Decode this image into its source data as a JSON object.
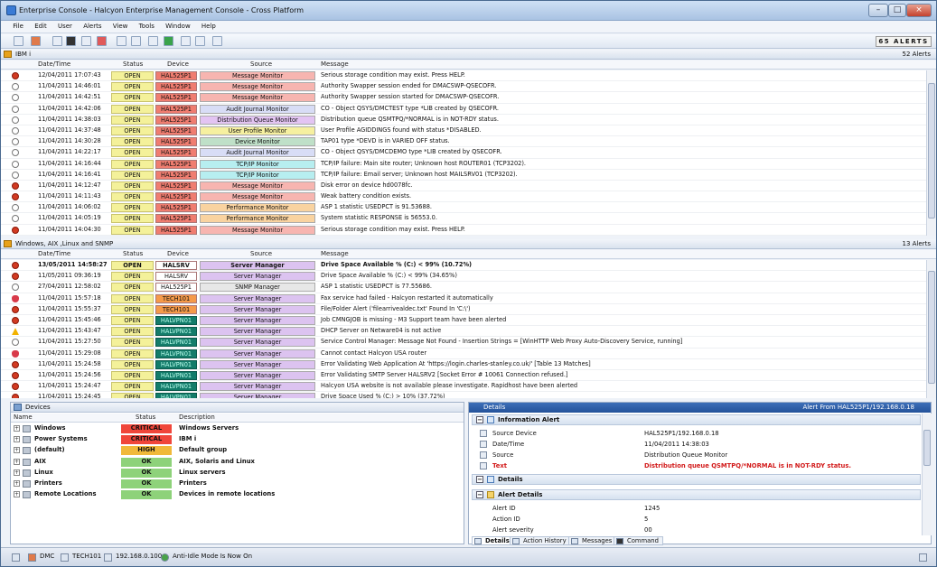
{
  "window": {
    "title": "Enterprise Console - Halcyon Enterprise Management Console - Cross Platform",
    "min": "–",
    "max": "□",
    "close": "×"
  },
  "menu": [
    "File",
    "Edit",
    "User",
    "Alerts",
    "View",
    "Tools",
    "Window",
    "Help"
  ],
  "alerts_total": "65 ALERTS",
  "panel1": {
    "title": "IBM i",
    "count": "52 Alerts",
    "columns": [
      "Date/Time",
      "Status",
      "Device",
      "Source",
      "Message"
    ],
    "rows": [
      {
        "icon": "err",
        "dt": "12/04/2011 17:07:43",
        "st": "OPEN",
        "dv": "HAL525P1",
        "sr": "Message Monitor",
        "sc": "#f7b5b0",
        "ms": "Serious storage condition may exist. Press HELP."
      },
      {
        "icon": "info",
        "dt": "11/04/2011 14:46:01",
        "st": "OPEN",
        "dv": "HAL525P1",
        "sr": "Message Monitor",
        "sc": "#f7b5b0",
        "ms": "Authority Swapper session ended for DMACSWP-QSECOFR."
      },
      {
        "icon": "info",
        "dt": "11/04/2011 14:42:51",
        "st": "OPEN",
        "dv": "HAL525P1",
        "sr": "Message Monitor",
        "sc": "#f7b5b0",
        "ms": "Authority Swapper session started for DMACSWP-QSECOFR."
      },
      {
        "icon": "info",
        "dt": "11/04/2011 14:42:06",
        "st": "OPEN",
        "dv": "HAL525P1",
        "sr": "Audit Journal Monitor",
        "sc": "#d8ddf6",
        "ms": "CO - Object QSYS/DMCTEST type *LIB created by QSECOFR."
      },
      {
        "icon": "info",
        "dt": "11/04/2011 14:38:03",
        "st": "OPEN",
        "dv": "HAL525P1",
        "sr": "Distribution Queue Monitor",
        "sc": "#e3c4f3",
        "ms": "Distribution queue QSMTPQ/*NORMAL is in NOT-RDY status."
      },
      {
        "icon": "info",
        "dt": "11/04/2011 14:37:48",
        "st": "OPEN",
        "dv": "HAL525P1",
        "sr": "User Profile Monitor",
        "sc": "#f6f0a0",
        "ms": "User Profile AGIDDINGS found with status *DISABLED."
      },
      {
        "icon": "info",
        "dt": "11/04/2011 14:30:28",
        "st": "OPEN",
        "dv": "HAL525P1",
        "sr": "Device Monitor",
        "sc": "#bfe0c8",
        "ms": "TAP01 type *DEVD is in VARIED OFF status."
      },
      {
        "icon": "info",
        "dt": "11/04/2011 14:22:17",
        "st": "OPEN",
        "dv": "HAL525P1",
        "sr": "Audit Journal Monitor",
        "sc": "#d8ddf6",
        "ms": "CO - Object QSYS/DMCDEMO type *LIB created by QSECOFR."
      },
      {
        "icon": "info",
        "dt": "11/04/2011 14:16:44",
        "st": "OPEN",
        "dv": "HAL525P1",
        "sr": "TCP/IP Monitor",
        "sc": "#b7eef0",
        "ms": "TCP/IP failure: Main site router; Unknown host ROUTER01 (TCP3202)."
      },
      {
        "icon": "info",
        "dt": "11/04/2011 14:16:41",
        "st": "OPEN",
        "dv": "HAL525P1",
        "sr": "TCP/IP Monitor",
        "sc": "#b7eef0",
        "ms": "TCP/IP failure: Email server; Unknown host MAILSRV01 (TCP3202)."
      },
      {
        "icon": "err",
        "dt": "11/04/2011 14:12:47",
        "st": "OPEN",
        "dv": "HAL525P1",
        "sr": "Message Monitor",
        "sc": "#f7b5b0",
        "ms": "Disk error on device hd0078fc."
      },
      {
        "icon": "err",
        "dt": "11/04/2011 14:11:43",
        "st": "OPEN",
        "dv": "HAL525P1",
        "sr": "Message Monitor",
        "sc": "#f7b5b0",
        "ms": "Weak battery condition exists."
      },
      {
        "icon": "info",
        "dt": "11/04/2011 14:06:02",
        "st": "OPEN",
        "dv": "HAL525P1",
        "sr": "Performance Monitor",
        "sc": "#f9d3a0",
        "ms": "ASP 1 statistic USEDPCT is 91.53688."
      },
      {
        "icon": "info",
        "dt": "11/04/2011 14:05:19",
        "st": "OPEN",
        "dv": "HAL525P1",
        "sr": "Performance Monitor",
        "sc": "#f9d3a0",
        "ms": "System statistic RESPONSE is 56553.0."
      },
      {
        "icon": "err",
        "dt": "11/04/2011 14:04:30",
        "st": "OPEN",
        "dv": "HAL525P1",
        "sr": "Message Monitor",
        "sc": "#f7b5b0",
        "ms": "Serious storage condition may exist. Press HELP."
      }
    ]
  },
  "panel2": {
    "title": "Windows, AIX ,Linux and SNMP",
    "count": "13 Alerts",
    "columns": [
      "Date/Time",
      "Status",
      "Device",
      "Source",
      "Message"
    ],
    "rows": [
      {
        "icon": "err",
        "bold": true,
        "dt": "13/05/2011 14:58:27",
        "st": "OPEN",
        "dv": "HALSRV",
        "dc": "#ffffff",
        "sr": "Server Manager",
        "sc": "#dcc3f0",
        "ms": "Drive Space Available % (C:) < 99% (10.72%)"
      },
      {
        "icon": "err",
        "dt": "11/05/2011 09:36:19",
        "st": "OPEN",
        "dv": "HALSRV",
        "dc": "#ffffff",
        "sr": "Server Manager",
        "sc": "#dcc3f0",
        "ms": "Drive Space Available % (C:) < 99% (34.65%)"
      },
      {
        "icon": "info",
        "dt": "27/04/2011 12:58:02",
        "st": "OPEN",
        "dv": "HAL525P1",
        "dc": "#ffffff",
        "sr": "SNMP Manager",
        "sc": "#e7e7e7",
        "ms": "ASP 1 statistic USEDPCT is 77.55686."
      },
      {
        "icon": "heart",
        "dt": "11/04/2011 15:57:18",
        "st": "OPEN",
        "dv": "TECH101",
        "dc": "#f59a4a",
        "sr": "Server Manager",
        "sc": "#dcc3f0",
        "ms": "Fax service had failed - Halcyon restarted it automatically"
      },
      {
        "icon": "err",
        "dt": "11/04/2011 15:55:37",
        "st": "OPEN",
        "dv": "TECH101",
        "dc": "#f59a4a",
        "sr": "Server Manager",
        "sc": "#dcc3f0",
        "ms": "File/Folder Alert ('filearrivealdec.txt' Found In 'C:\\')"
      },
      {
        "icon": "err",
        "dt": "11/04/2011 15:45:46",
        "st": "OPEN",
        "dv": "HALVPN01",
        "dc": "#137c6a",
        "sr": "Server Manager",
        "sc": "#dcc3f0",
        "ms": "Job CMNGJOB is missing - M3 Support team have been alerted"
      },
      {
        "icon": "warn",
        "dt": "11/04/2011 15:43:47",
        "st": "OPEN",
        "dv": "HALVPN01",
        "dc": "#137c6a",
        "sr": "Server Manager",
        "sc": "#dcc3f0",
        "ms": "DHCP Server on Netware04 is not active"
      },
      {
        "icon": "info",
        "dt": "11/04/2011 15:27:50",
        "st": "OPEN",
        "dv": "HALVPN01",
        "dc": "#137c6a",
        "sr": "Server Manager",
        "sc": "#dcc3f0",
        "ms": "Service Control Manager: Message Not Found - Insertion Strings = [WinHTTP Web Proxy Auto-Discovery Service, running]"
      },
      {
        "icon": "heart",
        "dt": "11/04/2011 15:29:08",
        "st": "OPEN",
        "dv": "HALVPN01",
        "dc": "#137c6a",
        "sr": "Server Manager",
        "sc": "#dcc3f0",
        "ms": "Cannot contact Halcyon USA router"
      },
      {
        "icon": "err",
        "dt": "11/04/2011 15:24:58",
        "st": "OPEN",
        "dv": "HALVPN01",
        "dc": "#137c6a",
        "sr": "Server Manager",
        "sc": "#dcc3f0",
        "ms": "Error Validating Web Application At 'https://login.charles-stanley.co.uk/' [Table 13 Matches]"
      },
      {
        "icon": "err",
        "dt": "11/04/2011 15:24:56",
        "st": "OPEN",
        "dv": "HALVPN01",
        "dc": "#137c6a",
        "sr": "Server Manager",
        "sc": "#dcc3f0",
        "ms": "Error Validating SMTP Server HALSRV2 [Socket Error # 10061 Connection refused.]"
      },
      {
        "icon": "err",
        "dt": "11/04/2011 15:24:47",
        "st": "OPEN",
        "dv": "HALVPN01",
        "dc": "#137c6a",
        "sr": "Server Manager",
        "sc": "#dcc3f0",
        "ms": "Halcyon USA website is not available please investigate. Rapidhost have been alerted"
      },
      {
        "icon": "err",
        "dt": "11/04/2011 15:24:45",
        "st": "OPEN",
        "dv": "HALVPN01",
        "dc": "#137c6a",
        "sr": "Server Manager",
        "sc": "#dcc3f0",
        "ms": "Drive Space Used % (C:) > 10% (37.72%)"
      }
    ]
  },
  "devices": {
    "title": "Devices",
    "columns": [
      "Name",
      "Status",
      "Description"
    ],
    "rows": [
      {
        "name": "Windows",
        "status": "CRITICAL",
        "color": "#f0463a",
        "desc": "Windows Servers"
      },
      {
        "name": "Power Systems",
        "status": "CRITICAL",
        "color": "#f0463a",
        "desc": "IBM i"
      },
      {
        "name": "(default)",
        "status": "HIGH",
        "color": "#f0b93a",
        "desc": "Default group"
      },
      {
        "name": "AIX",
        "status": "OK",
        "color": "#8ed27a",
        "desc": "AIX, Solaris and Linux"
      },
      {
        "name": "Linux",
        "status": "OK",
        "color": "#8ed27a",
        "desc": "Linux servers"
      },
      {
        "name": "Printers",
        "status": "OK",
        "color": "#8ed27a",
        "desc": "Printers"
      },
      {
        "name": "Remote Locations",
        "status": "OK",
        "color": "#8ed27a",
        "desc": "Devices in remote locations"
      }
    ]
  },
  "details": {
    "title": "Details",
    "from": "Alert From HAL525P1/192.168.0.18",
    "info_section": "Information Alert",
    "fields": [
      {
        "k": "Source Device",
        "v": "HAL525P1/192.168.0.18"
      },
      {
        "k": "Date/Time",
        "v": "11/04/2011 14:38:03"
      },
      {
        "k": "Source",
        "v": "Distribution Queue Monitor"
      },
      {
        "k": "Text",
        "v": "Distribution queue QSMTPQ/*NORMAL is in NOT-RDY status."
      }
    ],
    "details_section": "Details",
    "alert_details_section": "Alert Details",
    "alert_fields": [
      {
        "k": "Alert ID",
        "v": "1245"
      },
      {
        "k": "Action ID",
        "v": "5"
      },
      {
        "k": "Alert severity",
        "v": "00"
      }
    ],
    "tabs": [
      "Details",
      "Action History",
      "Messages",
      "Command"
    ]
  },
  "status": {
    "dmc": "DMC",
    "host": "TECH101",
    "ip": "192.168.0.100",
    "msg": "Anti-Idle Mode Is Now On"
  }
}
